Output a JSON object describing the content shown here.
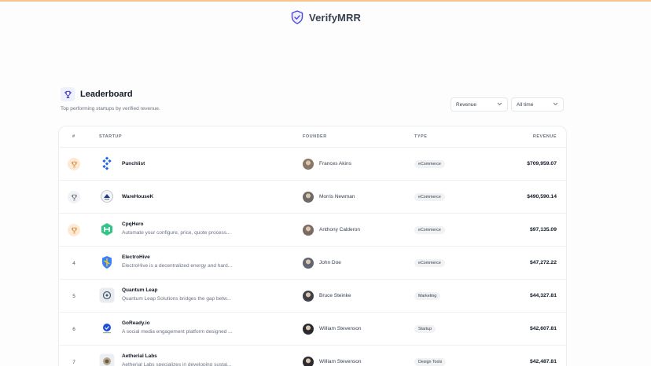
{
  "brand": {
    "name": "VerifyMRR"
  },
  "leaderboard": {
    "title": "Leaderboard",
    "subtitle": "Top performing startups by verified revenue.",
    "filters": {
      "metric": "Revenue",
      "period": "All time"
    }
  },
  "table": {
    "headers": {
      "rank": "#",
      "startup": "STARTUP",
      "founder": "FOUNDER",
      "type": "TYPE",
      "revenue": "REVENUE"
    },
    "rows": [
      {
        "rank": "",
        "medal": "gold",
        "name": "Punchlist",
        "desc": "",
        "founder": "Frances Akins",
        "type": "eCommerce",
        "revenue": "$709,959.07"
      },
      {
        "rank": "",
        "medal": "silver",
        "name": "WareHouseK",
        "desc": "",
        "founder": "Morris Newman",
        "type": "eCommerce",
        "revenue": "$490,590.14"
      },
      {
        "rank": "",
        "medal": "bronze",
        "name": "CpqHero",
        "desc": "Automate your configure, price, quote process...",
        "founder": "Anthony Calderon",
        "type": "eCommerce",
        "revenue": "$97,135.09"
      },
      {
        "rank": "4",
        "medal": "",
        "name": "ElectroHive",
        "desc": "ElectroHive is a decentralized energy and hard...",
        "founder": "John Doe",
        "type": "eCommerce",
        "revenue": "$47,272.22"
      },
      {
        "rank": "5",
        "medal": "",
        "name": "Quantum Leap",
        "desc": "Quantum Leap Solutions bridges the gap betw...",
        "founder": "Bruce Steinke",
        "type": "Marketing",
        "revenue": "$44,327.81"
      },
      {
        "rank": "6",
        "medal": "",
        "name": "GoReady.io",
        "desc": "A social media engagement platform designed ...",
        "founder": "William Stevenson",
        "type": "Startup",
        "revenue": "$42,607.81"
      },
      {
        "rank": "7",
        "medal": "",
        "name": "Aetherial Labs",
        "desc": "Aetherial Labs specializes in developing sustai...",
        "founder": "William Stevenson",
        "type": "Design Tools",
        "revenue": "$42,487.81"
      }
    ]
  }
}
